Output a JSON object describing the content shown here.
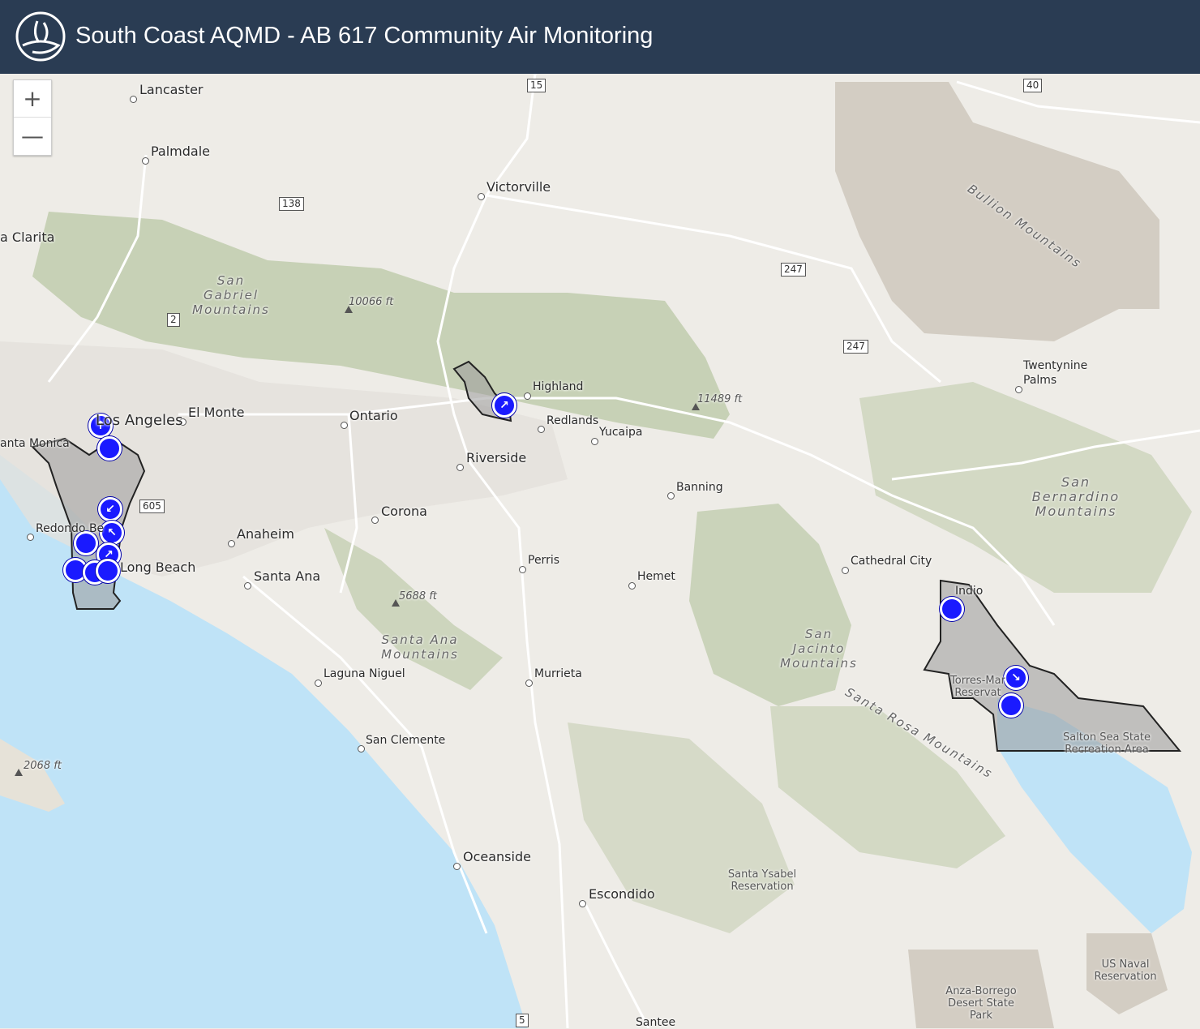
{
  "header": {
    "title": "South Coast AQMD - AB 617 Community Air Monitoring",
    "background": "#2a3c53"
  },
  "zoom": {
    "in_label": "+",
    "out_label": "—"
  },
  "cities": {
    "lancaster": "Lancaster",
    "palmdale": "Palmdale",
    "victorville": "Victorville",
    "clarita": "a Clarita",
    "los_angeles": "Los Angeles",
    "el_monte": "El Monte",
    "santa_monica": "anta Monica",
    "ontario": "Ontario",
    "highland": "Highland",
    "redlands": "Redlands",
    "yucaipa": "Yucaipa",
    "riverside": "Riverside",
    "corona": "Corona",
    "redondo": "Redondo Be",
    "anaheim": "Anaheim",
    "long_beach": "Long Beach",
    "santa_ana": "Santa Ana",
    "banning": "Banning",
    "perris": "Perris",
    "hemet": "Hemet",
    "cathedral_city": "Cathedral City",
    "indio": "Indio",
    "twentynine_palms": "Twentynine Palms",
    "laguna_niguel": "Laguna Niguel",
    "murrieta": "Murrieta",
    "san_clemente": "San Clemente",
    "oceanside": "Oceanside",
    "escondido": "Escondido",
    "santee": "Santee"
  },
  "terrain": {
    "san_gabriel": "San Gabriel Mountains",
    "bullion": "Bullion Mountains",
    "san_bernardino": "San Bernardino Mountains",
    "santa_ana_mtns": "Santa Ana Mountains",
    "san_jacinto": "San Jacinto Mountains",
    "santa_rosa": "Santa Rosa Mountains"
  },
  "elevations": {
    "e1": "10066 ft",
    "e2": "11489 ft",
    "e3": "5688 ft",
    "e4": "2068 ft"
  },
  "parks": {
    "torres": "Torres-Mar Reservat",
    "salton": "Salton Sea State Recreation Area",
    "santa_ysabel": "Santa Ysabel Reservation",
    "us_naval": "US Naval Reservation",
    "anza": "Anza-Borrego Desert State Park"
  },
  "routes": {
    "r15": "15",
    "r40": "40",
    "r138": "138",
    "r247a": "247",
    "r247b": "247",
    "r2": "2",
    "r605": "605",
    "r5": "5"
  },
  "colors": {
    "water": "#bfe3f7",
    "land": "#eeece7",
    "mountain": "#b7c6a1",
    "desert": "#d3cdc3",
    "marker": "#1a1aff",
    "community": "#9a9a9a"
  }
}
